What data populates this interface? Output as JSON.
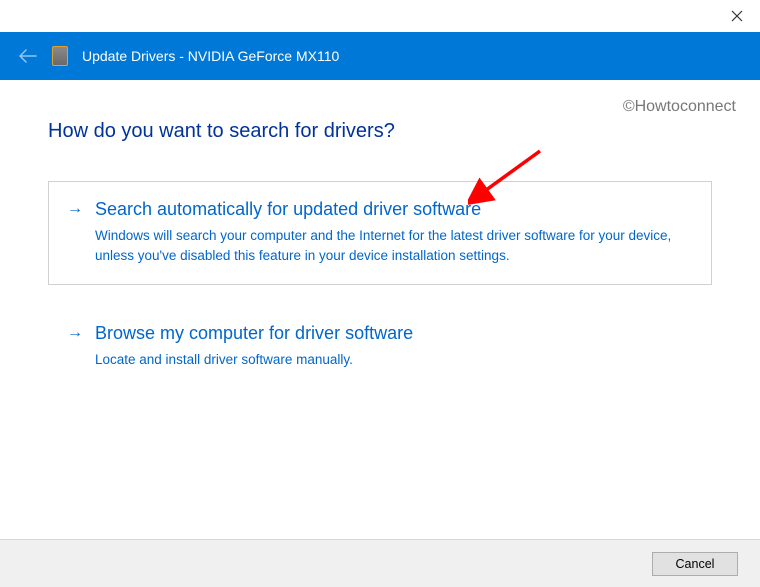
{
  "header": {
    "title": "Update Drivers - NVIDIA GeForce MX110"
  },
  "watermark": "©Howtoconnect",
  "heading": "How do you want to search for drivers?",
  "options": {
    "auto": {
      "title": "Search automatically for updated driver software",
      "desc": "Windows will search your computer and the Internet for the latest driver software for your device, unless you've disabled this feature in your device installation settings."
    },
    "browse": {
      "title": "Browse my computer for driver software",
      "desc": "Locate and install driver software manually."
    }
  },
  "footer": {
    "cancel_label": "Cancel"
  }
}
